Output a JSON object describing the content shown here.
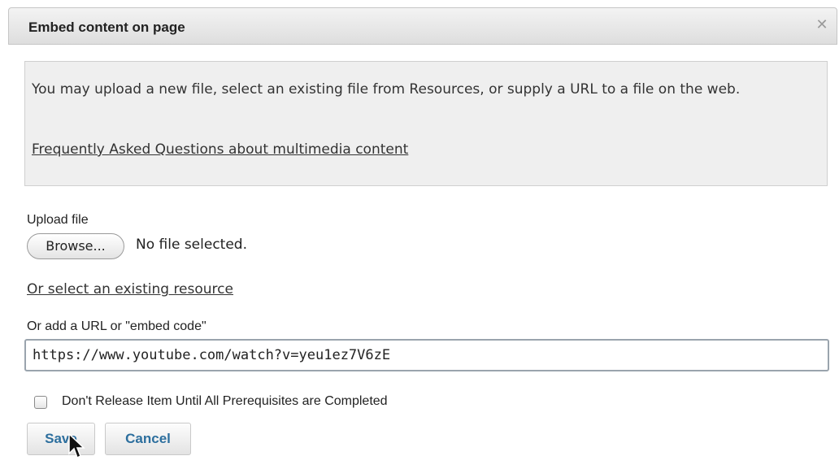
{
  "dialog": {
    "title": "Embed content on page",
    "close_icon": "close-icon"
  },
  "info": {
    "text": "You may upload a new file, select an existing file from Resources, or supply a URL to a file on the web.",
    "faq_link": "Frequently Asked Questions about multimedia content"
  },
  "upload": {
    "label": "Upload file",
    "browse_label": "Browse...",
    "status": "No file selected."
  },
  "existing_link": "Or select an existing resource",
  "url": {
    "label": "Or add a URL or \"embed code\"",
    "value": "https://www.youtube.com/watch?v=yeu1ez7V6zE"
  },
  "prerequisites": {
    "label": "Don't Release Item Until All Prerequisites are Completed",
    "checked": false
  },
  "buttons": {
    "save": "Save",
    "cancel": "Cancel"
  },
  "colors": {
    "button_text": "#2d6f9e",
    "info_background": "#efefef"
  }
}
